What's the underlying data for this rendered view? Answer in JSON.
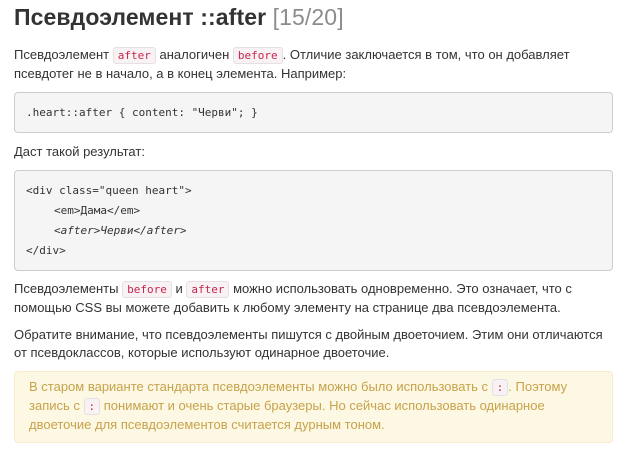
{
  "header": {
    "title": "Псевдоэлемент ::after",
    "counter": "[15/20]"
  },
  "intro": {
    "t1": "Псевдоэлемент ",
    "c1": "after",
    "t2": " аналогичен ",
    "c2": "before",
    "t3": ". Отличие заключается в том, что он добавляет",
    "t4": "псевдотег не в начало, а в конец элемента. Например:"
  },
  "code_example_1": ".heart::after { content: \"Черви\"; }",
  "result_label": "Даст такой результат:",
  "code_example_2": {
    "line1": "<div class=\"queen heart\">",
    "line2": "<em>Дама</em>",
    "line3": "<after>Черви</after>",
    "line4": "</div>"
  },
  "para2": {
    "t1": "Псевдоэлементы ",
    "c1": "before",
    "t2": " и ",
    "c2": "after",
    "t3": " можно использовать одновременно. Это означает, что с",
    "t4": "помощью CSS вы можете добавить к любому элементу на странице два псевдоэлемента."
  },
  "para3": {
    "line1": "Обратите внимание, что псевдоэлементы пишутся с двойным двоеточием. Этим они отличаются",
    "line2": "от псевдоклассов, которые используют одинарное двоеточие."
  },
  "warning": {
    "t1": "В старом варианте стандарта псевдоэлементы можно было использовать с ",
    "c1": ":",
    "t2": ". Поэтому",
    "t3": "запись с ",
    "c2": ":",
    "t4": " понимают и очень старые браузеры. Но сейчас использовать одинарное",
    "t5": "двоеточие для псевдоэлементов считается дурным тоном."
  },
  "colors": {
    "text": "#333333",
    "counter": "#8c8c8c",
    "inline_code": "#c7254e",
    "warning_bg": "#fcf8e3",
    "warning_text": "#c8a24b"
  }
}
